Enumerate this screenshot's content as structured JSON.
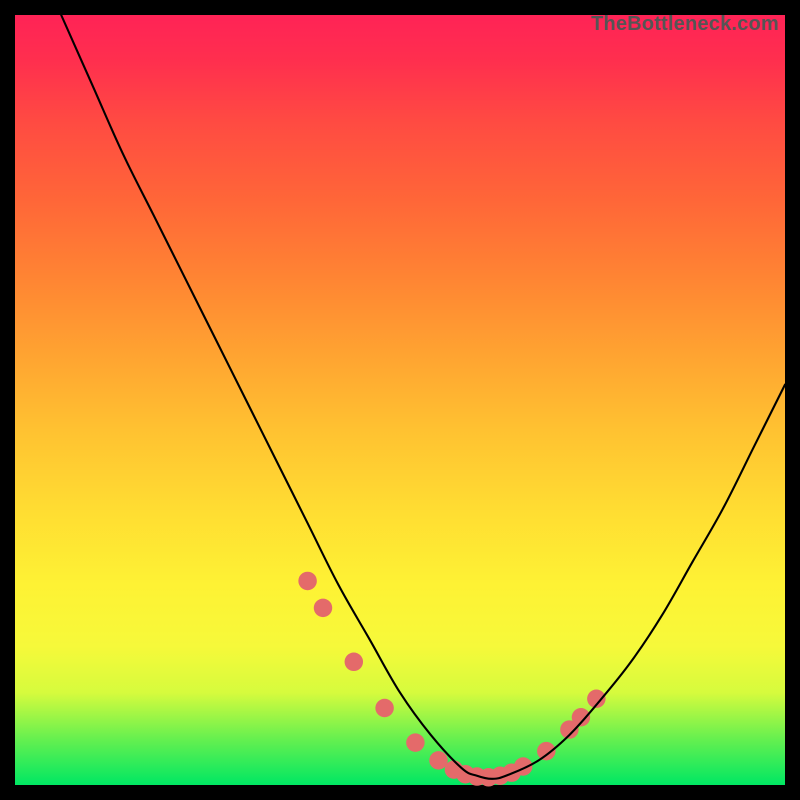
{
  "watermark": "TheBottleneck.com",
  "chart_data": {
    "type": "line",
    "title": "",
    "xlabel": "",
    "ylabel": "",
    "xlim": [
      0,
      100
    ],
    "ylim": [
      0,
      100
    ],
    "grid": false,
    "legend": false,
    "series": [
      {
        "name": "curve",
        "x": [
          6,
          10,
          14,
          18,
          22,
          26,
          30,
          34,
          38,
          42,
          46,
          50,
          54,
          58,
          60,
          62,
          64,
          68,
          72,
          76,
          80,
          84,
          88,
          92,
          96,
          100
        ],
        "y": [
          100,
          91,
          82,
          74,
          66,
          58,
          50,
          42,
          34,
          26,
          19,
          12,
          6.5,
          2.2,
          1.2,
          0.8,
          1.3,
          3.2,
          6.5,
          11,
          16,
          22,
          29,
          36,
          44,
          52
        ]
      }
    ],
    "markers": {
      "name": "red-dots",
      "color": "#e46a6a",
      "radius_pct": 1.2,
      "points_x": [
        38,
        40,
        44,
        48,
        52,
        55,
        57,
        58.5,
        60,
        61.5,
        63,
        64.5,
        66,
        69,
        72,
        73.5,
        75.5
      ],
      "points_y": [
        26.5,
        23,
        16,
        10,
        5.5,
        3.2,
        2.0,
        1.4,
        1.1,
        1.0,
        1.2,
        1.6,
        2.4,
        4.4,
        7.2,
        8.8,
        11.2
      ]
    },
    "background_gradient_top_to_bottom": [
      "#ff2356",
      "#ff8433",
      "#fef234",
      "#00e763"
    ]
  }
}
